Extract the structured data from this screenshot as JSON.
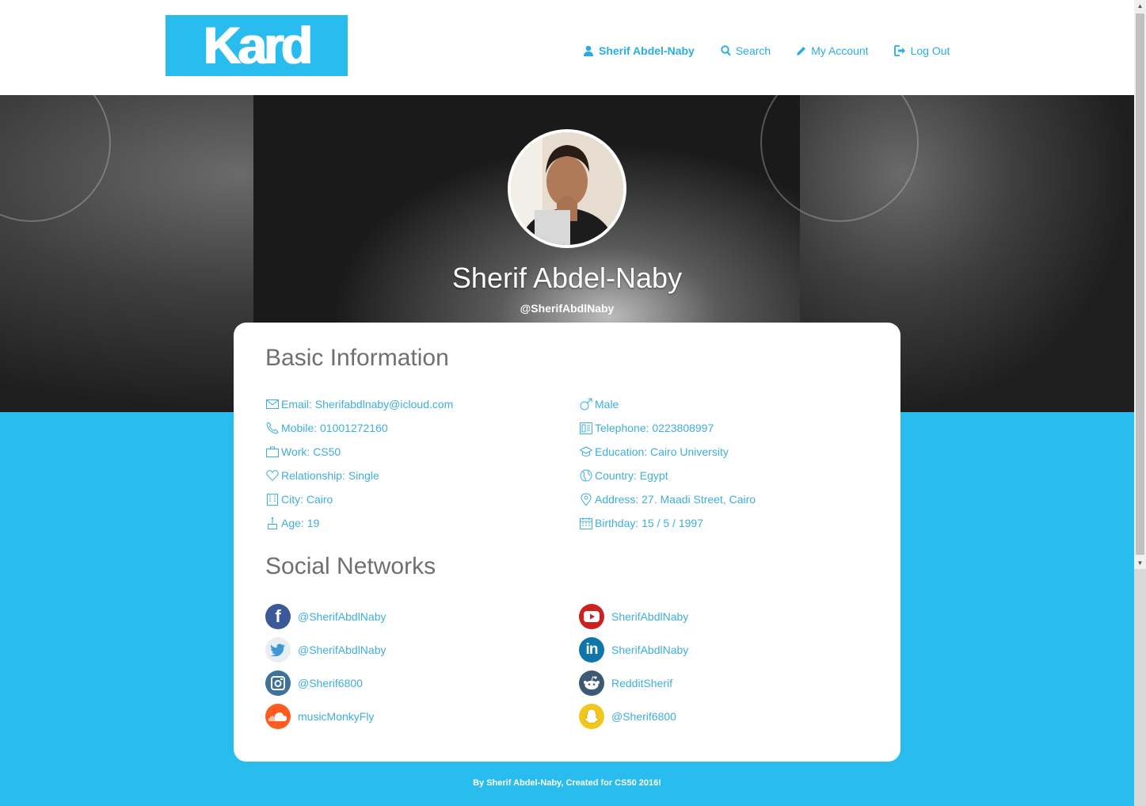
{
  "header": {
    "logo_text": "Kard",
    "nav": {
      "user_label": "Sherif Abdel-Naby",
      "search_label": "Search",
      "account_label": "My Account",
      "logout_label": "Log Out"
    }
  },
  "profile": {
    "name": "Sherif Abdel-Naby",
    "handle": "@SherifAbdlNaby"
  },
  "basic_info": {
    "title": "Basic Information",
    "left": [
      {
        "icon": "envelope-icon",
        "text": "Email: Sherifabdlnaby@icloud.com"
      },
      {
        "icon": "phone-icon",
        "text": "Mobile: 01001272160"
      },
      {
        "icon": "briefcase-icon",
        "text": "Work: CS50"
      },
      {
        "icon": "heart-icon",
        "text": "Relationship: Single"
      },
      {
        "icon": "building-icon",
        "text": "City: Cairo"
      },
      {
        "icon": "cake-icon",
        "text": "Age: 19"
      }
    ],
    "right": [
      {
        "icon": "male-icon",
        "text": "Male"
      },
      {
        "icon": "telephone-icon",
        "text": "Telephone: 0223808997"
      },
      {
        "icon": "graduation-cap-icon",
        "text": "Education: Cairo University"
      },
      {
        "icon": "globe-icon",
        "text": "Country: Egypt"
      },
      {
        "icon": "map-pin-icon",
        "text": "Address: 27. Maadi Street, Cairo"
      },
      {
        "icon": "calendar-icon",
        "text": "Birthday: 15 / 5 / 1997"
      }
    ]
  },
  "social": {
    "title": "Social Networks",
    "left": [
      {
        "icon": "facebook-icon",
        "text": "@SherifAbdlNaby",
        "color": "#3b5998"
      },
      {
        "icon": "twitter-icon",
        "text": "@SherifAbdlNaby",
        "color": "#e1e8ed"
      },
      {
        "icon": "instagram-icon",
        "text": "@Sherif6800",
        "color": "#3f729b"
      },
      {
        "icon": "soundcloud-icon",
        "text": "musicMonkyFly",
        "color": "#ff5500"
      }
    ],
    "right": [
      {
        "icon": "youtube-icon",
        "text": "SherifAbdlNaby",
        "color": "#cd201f"
      },
      {
        "icon": "linkedin-icon",
        "text": "SherifAbdlNaby",
        "color": "#0077b5"
      },
      {
        "icon": "reddit-icon",
        "text": "RedditSherif",
        "color": "#3d5a74"
      },
      {
        "icon": "snapchat-icon",
        "text": "@Sherif6800",
        "color": "#f5c518"
      }
    ]
  },
  "footer": {
    "text": "By Sherif Abdel-Naby, Created for CS50 2016!"
  },
  "colors": {
    "accent": "#29bdef",
    "link": "#3eaedb",
    "heading": "#6f6f6f"
  }
}
